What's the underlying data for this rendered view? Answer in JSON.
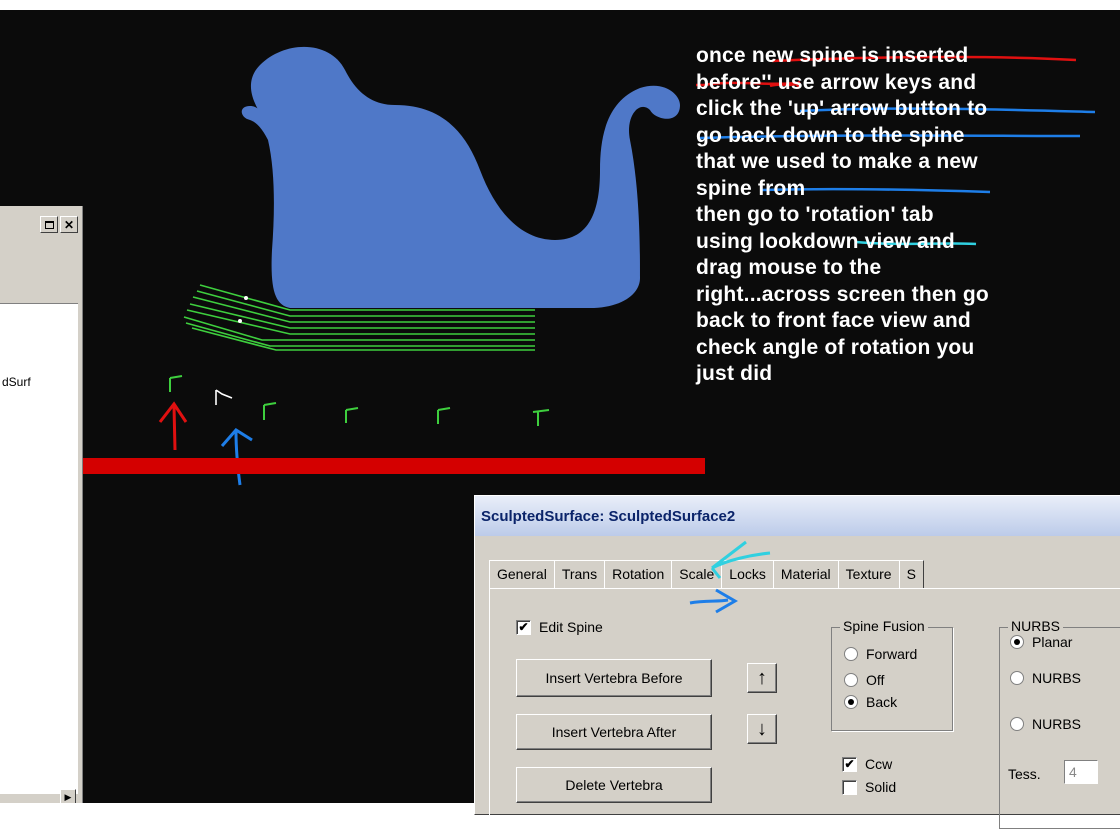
{
  "left_window": {
    "list_item": "dSurf"
  },
  "annotation_text": {
    "lines": [
      "once new spine is inserted",
      "before'' use arrow keys and",
      "click the 'up' arrow button to",
      "go back down to the spine",
      "that we used to make a new",
      "spine from",
      "then go to 'rotation' tab",
      "using lookdown view and",
      "drag mouse to the",
      "right...across screen then go",
      "back to front face view and",
      "check angle of rotation you",
      "just did"
    ]
  },
  "dialog": {
    "title": "SculptedSurface:  SculptedSurface2",
    "tabs": [
      "General",
      "Trans",
      "Rotation",
      "Scale",
      "Locks",
      "Material",
      "Texture",
      "S"
    ],
    "edit_spine_label": "Edit Spine",
    "edit_spine_checked": true,
    "insert_before_label": "Insert Vertebra Before",
    "insert_after_label": "Insert Vertebra After",
    "delete_label": "Delete Vertebra",
    "spine_fusion": {
      "legend": "Spine Fusion",
      "options": [
        "Forward",
        "Off",
        "Back"
      ],
      "selected": "Back"
    },
    "ccw_label": "Ccw",
    "ccw_checked": true,
    "solid_label": "Solid",
    "solid_checked": false,
    "nurbs": {
      "legend": "NURBS",
      "options": [
        "Planar",
        "NURBS",
        "NURBS"
      ],
      "selected": "Planar"
    },
    "tess_label": "Tess.",
    "tess_value": "4"
  },
  "colors": {
    "viewport_bg": "#0b0b0b",
    "shape_fill": "#4f78c8",
    "spine_green": "#3ecf3e",
    "red_bar": "#d40000",
    "annotation_red": "#e01010",
    "annotation_blue": "#1e7ee8",
    "annotation_cyan": "#30d0e0"
  }
}
